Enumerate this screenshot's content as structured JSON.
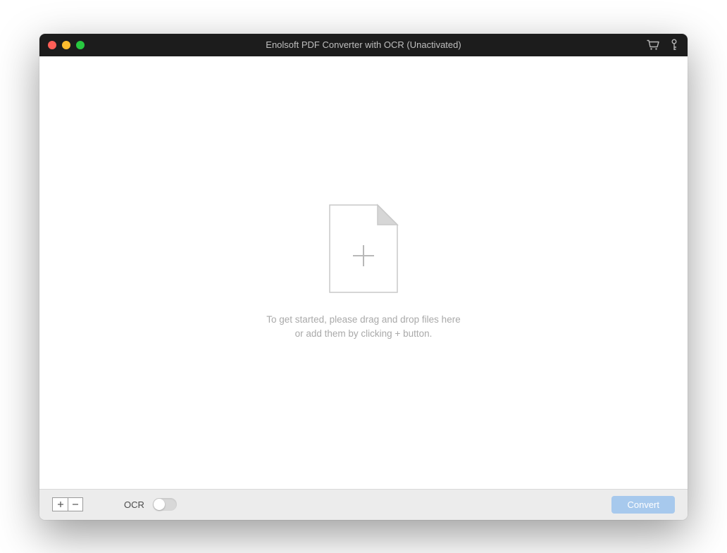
{
  "titlebar": {
    "title": "Enolsoft PDF Converter with OCR (Unactivated)"
  },
  "dropzone": {
    "line1": "To get started, please drag and drop files here",
    "line2": "or add them by clicking + button."
  },
  "bottombar": {
    "ocr_label": "OCR",
    "convert_label": "Convert"
  }
}
